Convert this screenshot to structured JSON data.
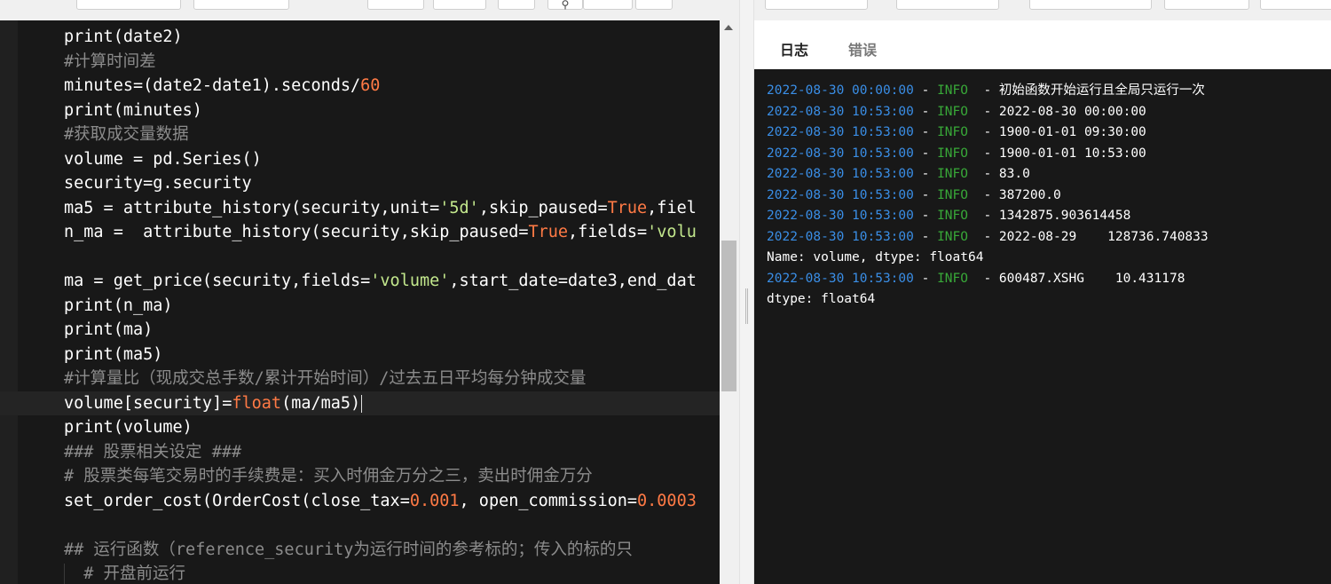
{
  "editor": {
    "lines": [
      {
        "num": "",
        "segments": [
          {
            "t": "print(date2)",
            "c": ""
          }
        ]
      },
      {
        "num": "",
        "segments": [
          {
            "t": "#计算时间差",
            "c": "c-com"
          }
        ]
      },
      {
        "num": "",
        "segments": [
          {
            "t": "minutes=(date2-date1).seconds/",
            "c": ""
          },
          {
            "t": "60",
            "c": "c-num"
          }
        ]
      },
      {
        "num": "",
        "segments": [
          {
            "t": "print(minutes)",
            "c": ""
          }
        ]
      },
      {
        "num": "",
        "segments": [
          {
            "t": "#获取成交量数据",
            "c": "c-com"
          }
        ]
      },
      {
        "num": "",
        "segments": [
          {
            "t": "volume = pd.Series()",
            "c": ""
          }
        ]
      },
      {
        "num": "",
        "segments": [
          {
            "t": "security=g.security",
            "c": ""
          }
        ]
      },
      {
        "num": "",
        "segments": [
          {
            "t": "ma5 = attribute_history(security,unit=",
            "c": ""
          },
          {
            "t": "'5d'",
            "c": "c-str"
          },
          {
            "t": ",skip_paused=",
            "c": ""
          },
          {
            "t": "True",
            "c": "c-kw"
          },
          {
            "t": ",fiel",
            "c": ""
          }
        ]
      },
      {
        "num": "",
        "segments": [
          {
            "t": "n_ma =  attribute_history(security,skip_paused=",
            "c": ""
          },
          {
            "t": "True",
            "c": "c-kw"
          },
          {
            "t": ",fields=",
            "c": ""
          },
          {
            "t": "'volu",
            "c": "c-str"
          }
        ]
      },
      {
        "num": "",
        "segments": []
      },
      {
        "num": "",
        "segments": [
          {
            "t": "ma = get_price(security,fields=",
            "c": ""
          },
          {
            "t": "'volume'",
            "c": "c-str"
          },
          {
            "t": ",start_date=date3,end_dat",
            "c": ""
          }
        ]
      },
      {
        "num": "",
        "segments": [
          {
            "t": "print(n_ma)",
            "c": ""
          }
        ]
      },
      {
        "num": "",
        "segments": [
          {
            "t": "print(ma)",
            "c": ""
          }
        ]
      },
      {
        "num": "",
        "segments": [
          {
            "t": "print(ma5)",
            "c": ""
          }
        ]
      },
      {
        "num": "",
        "segments": [
          {
            "t": "#计算量比（现成交总手数/累计开始时间）/过去五日平均每分钟成交量",
            "c": "c-com"
          }
        ]
      },
      {
        "num": "",
        "segments": [
          {
            "t": "volume[security]=",
            "c": ""
          },
          {
            "t": "float",
            "c": "c-kw"
          },
          {
            "t": "(ma/ma5)",
            "c": ""
          }
        ]
      },
      {
        "num": "",
        "segments": [
          {
            "t": "print(volume)",
            "c": ""
          }
        ]
      },
      {
        "num": "",
        "segments": [
          {
            "t": "### 股票相关设定 ###",
            "c": "c-com"
          }
        ]
      },
      {
        "num": "",
        "segments": [
          {
            "t": "# 股票类每笔交易时的手续费是：买入时佣金万分之三，卖出时佣金万分",
            "c": "c-com"
          }
        ]
      },
      {
        "num": "",
        "segments": [
          {
            "t": "set_order_cost(OrderCost(close_tax=",
            "c": ""
          },
          {
            "t": "0.001",
            "c": "c-num"
          },
          {
            "t": ", open_commission=",
            "c": ""
          },
          {
            "t": "0.0003",
            "c": "c-num"
          }
        ]
      },
      {
        "num": "",
        "segments": []
      },
      {
        "num": "",
        "segments": [
          {
            "t": "## 运行函数（reference_security为运行时间的参考标的；传入的标的只",
            "c": "c-com"
          }
        ]
      },
      {
        "num": "",
        "segments": [
          {
            "t": "  # 开盘前运行",
            "c": "c-com"
          }
        ]
      }
    ]
  },
  "tabs": {
    "log_label": "日志",
    "error_label": "错误"
  },
  "log": {
    "lines": [
      {
        "date": "2022-08-30 00:00:00",
        "sep1": " - ",
        "level": "INFO",
        "sep2": "  - ",
        "msg": "初始函数开始运行且全局只运行一次"
      },
      {
        "date": "2022-08-30 10:53:00",
        "sep1": " - ",
        "level": "INFO",
        "sep2": "  - ",
        "msg": "2022-08-30 00:00:00"
      },
      {
        "date": "2022-08-30 10:53:00",
        "sep1": " - ",
        "level": "INFO",
        "sep2": "  - ",
        "msg": "1900-01-01 09:30:00"
      },
      {
        "date": "2022-08-30 10:53:00",
        "sep1": " - ",
        "level": "INFO",
        "sep2": "  - ",
        "msg": "1900-01-01 10:53:00"
      },
      {
        "date": "2022-08-30 10:53:00",
        "sep1": " - ",
        "level": "INFO",
        "sep2": "  - ",
        "msg": "83.0"
      },
      {
        "date": "2022-08-30 10:53:00",
        "sep1": " - ",
        "level": "INFO",
        "sep2": "  - ",
        "msg": "387200.0"
      },
      {
        "date": "2022-08-30 10:53:00",
        "sep1": " - ",
        "level": "INFO",
        "sep2": "  - ",
        "msg": "1342875.903614458"
      },
      {
        "date": "2022-08-30 10:53:00",
        "sep1": " - ",
        "level": "INFO",
        "sep2": "  - ",
        "msg": "2022-08-29    128736.740833"
      },
      {
        "date": "",
        "sep1": "",
        "level": "",
        "sep2": "",
        "msg": "Name: volume, dtype: float64"
      },
      {
        "date": "2022-08-30 10:53:00",
        "sep1": " - ",
        "level": "INFO",
        "sep2": "  - ",
        "msg": "600487.XSHG    10.431178"
      },
      {
        "date": "",
        "sep1": "",
        "level": "",
        "sep2": "",
        "msg": "dtype: float64"
      }
    ]
  }
}
